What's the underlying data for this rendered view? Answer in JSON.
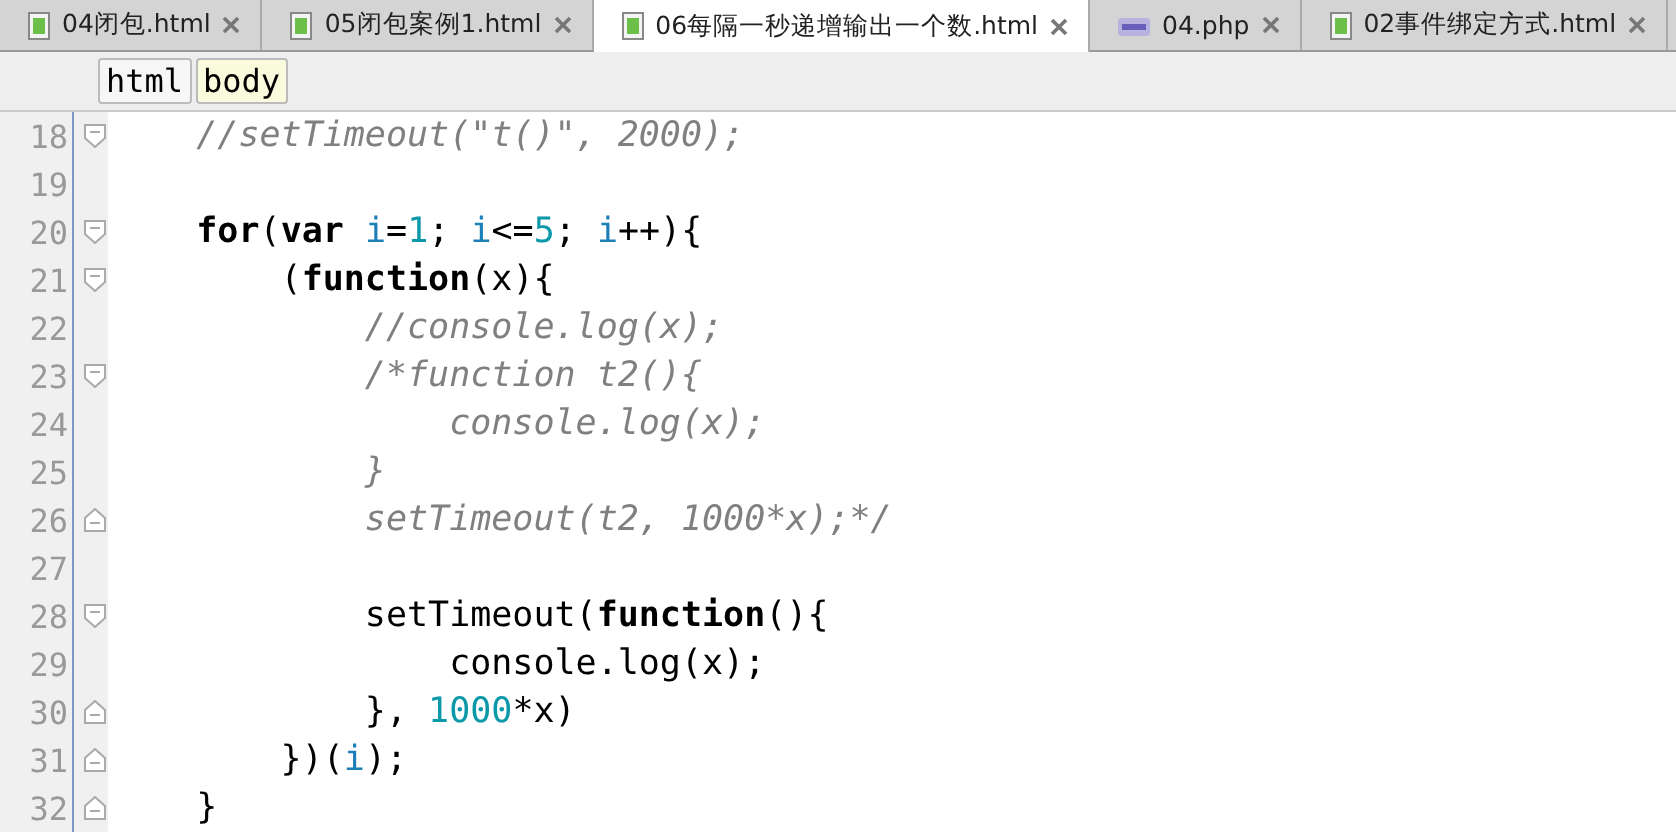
{
  "tabs": [
    {
      "label": "04闭包.html",
      "kind": "html",
      "selected": false
    },
    {
      "label": "05闭包案例1.html",
      "kind": "html",
      "selected": false
    },
    {
      "label": "06每隔一秒递增输出一个数.html",
      "kind": "html",
      "selected": true
    },
    {
      "label": "04.php",
      "kind": "php",
      "selected": false
    },
    {
      "label": "02事件绑定方式.html",
      "kind": "html",
      "selected": false
    }
  ],
  "breadcrumbs": [
    {
      "label": "html",
      "selected": false
    },
    {
      "label": "body",
      "selected": true
    }
  ],
  "lines": [
    {
      "number": "18",
      "kind": "fold-start",
      "tokens": [
        {
          "kind": "comment",
          "text": "    //setTimeout(\"t()\", 2000);"
        }
      ]
    },
    {
      "number": "19",
      "kind": "plain"
    },
    {
      "number": "20",
      "kind": "fold-start",
      "tokens": [
        {
          "kind": "keyword",
          "text": "    for"
        },
        {
          "kind": "plain",
          "text": "("
        },
        {
          "kind": "keyword",
          "text": "var "
        },
        {
          "kind": "variable",
          "text": "i"
        },
        {
          "kind": "plain",
          "text": "="
        },
        {
          "kind": "number",
          "text": "1"
        },
        {
          "kind": "plain",
          "text": "; "
        },
        {
          "kind": "variable",
          "text": "i"
        },
        {
          "kind": "plain",
          "text": "<="
        },
        {
          "kind": "number",
          "text": "5"
        },
        {
          "kind": "plain",
          "text": "; "
        },
        {
          "kind": "variable",
          "text": "i"
        },
        {
          "kind": "plain",
          "text": "++){"
        }
      ]
    },
    {
      "number": "21",
      "kind": "fold-start",
      "tokens": [
        {
          "kind": "plain",
          "text": "        ("
        },
        {
          "kind": "keyword",
          "text": "function"
        },
        {
          "kind": "plain",
          "text": "(x){"
        }
      ]
    },
    {
      "number": "22",
      "kind": "plain",
      "tokens": [
        {
          "kind": "comment",
          "text": "            //console.log(x);"
        }
      ]
    },
    {
      "number": "23",
      "kind": "fold-start",
      "tokens": [
        {
          "kind": "comment",
          "text": "            /*function t2(){"
        }
      ]
    },
    {
      "number": "24",
      "kind": "plain",
      "tokens": [
        {
          "kind": "comment",
          "text": "                console.log(x);"
        }
      ]
    },
    {
      "number": "25",
      "kind": "plain",
      "tokens": [
        {
          "kind": "comment",
          "text": "            }"
        }
      ]
    },
    {
      "number": "26",
      "kind": "fold-end",
      "tokens": [
        {
          "kind": "comment",
          "text": "            setTimeout(t2, 1000*x);*/"
        }
      ]
    },
    {
      "number": "27",
      "kind": "plain"
    },
    {
      "number": "28",
      "kind": "fold-start",
      "tokens": [
        {
          "kind": "plain",
          "text": "            setTimeout("
        },
        {
          "kind": "keyword",
          "text": "function"
        },
        {
          "kind": "plain",
          "text": "(){"
        }
      ]
    },
    {
      "number": "29",
      "kind": "plain",
      "tokens": [
        {
          "kind": "plain",
          "text": "                console.log(x);"
        }
      ]
    },
    {
      "number": "30",
      "kind": "fold-end",
      "tokens": [
        {
          "kind": "plain",
          "text": "            }, "
        },
        {
          "kind": "number",
          "text": "1000"
        },
        {
          "kind": "plain",
          "text": "*x)"
        }
      ]
    },
    {
      "number": "31",
      "kind": "fold-end",
      "tokens": [
        {
          "kind": "plain",
          "text": "        })("
        },
        {
          "kind": "variable",
          "text": "i"
        },
        {
          "kind": "plain",
          "text": ");"
        }
      ]
    },
    {
      "number": "32",
      "kind": "fold-end",
      "tokens": [
        {
          "kind": "plain",
          "text": "    }"
        }
      ]
    }
  ]
}
